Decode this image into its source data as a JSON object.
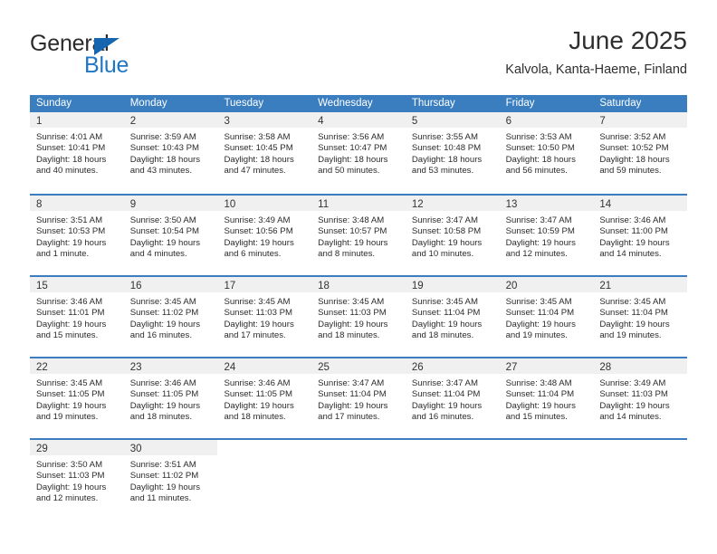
{
  "logo": {
    "word_top": "General",
    "word_bottom": "Blue",
    "triangle_color": "#1565b0",
    "blue_color": "#1f77c4"
  },
  "header": {
    "title": "June 2025",
    "location": "Kalvola, Kanta-Haeme, Finland"
  },
  "calendar": {
    "accent_color": "#3a7ebf",
    "date_band_color": "#f0f0f0",
    "weekdays": [
      "Sunday",
      "Monday",
      "Tuesday",
      "Wednesday",
      "Thursday",
      "Friday",
      "Saturday"
    ],
    "weeks": [
      [
        {
          "date": "1",
          "sunrise": "Sunrise: 4:01 AM",
          "sunset": "Sunset: 10:41 PM",
          "daylight_line1": "Daylight: 18 hours",
          "daylight_line2": "and 40 minutes."
        },
        {
          "date": "2",
          "sunrise": "Sunrise: 3:59 AM",
          "sunset": "Sunset: 10:43 PM",
          "daylight_line1": "Daylight: 18 hours",
          "daylight_line2": "and 43 minutes."
        },
        {
          "date": "3",
          "sunrise": "Sunrise: 3:58 AM",
          "sunset": "Sunset: 10:45 PM",
          "daylight_line1": "Daylight: 18 hours",
          "daylight_line2": "and 47 minutes."
        },
        {
          "date": "4",
          "sunrise": "Sunrise: 3:56 AM",
          "sunset": "Sunset: 10:47 PM",
          "daylight_line1": "Daylight: 18 hours",
          "daylight_line2": "and 50 minutes."
        },
        {
          "date": "5",
          "sunrise": "Sunrise: 3:55 AM",
          "sunset": "Sunset: 10:48 PM",
          "daylight_line1": "Daylight: 18 hours",
          "daylight_line2": "and 53 minutes."
        },
        {
          "date": "6",
          "sunrise": "Sunrise: 3:53 AM",
          "sunset": "Sunset: 10:50 PM",
          "daylight_line1": "Daylight: 18 hours",
          "daylight_line2": "and 56 minutes."
        },
        {
          "date": "7",
          "sunrise": "Sunrise: 3:52 AM",
          "sunset": "Sunset: 10:52 PM",
          "daylight_line1": "Daylight: 18 hours",
          "daylight_line2": "and 59 minutes."
        }
      ],
      [
        {
          "date": "8",
          "sunrise": "Sunrise: 3:51 AM",
          "sunset": "Sunset: 10:53 PM",
          "daylight_line1": "Daylight: 19 hours",
          "daylight_line2": "and 1 minute."
        },
        {
          "date": "9",
          "sunrise": "Sunrise: 3:50 AM",
          "sunset": "Sunset: 10:54 PM",
          "daylight_line1": "Daylight: 19 hours",
          "daylight_line2": "and 4 minutes."
        },
        {
          "date": "10",
          "sunrise": "Sunrise: 3:49 AM",
          "sunset": "Sunset: 10:56 PM",
          "daylight_line1": "Daylight: 19 hours",
          "daylight_line2": "and 6 minutes."
        },
        {
          "date": "11",
          "sunrise": "Sunrise: 3:48 AM",
          "sunset": "Sunset: 10:57 PM",
          "daylight_line1": "Daylight: 19 hours",
          "daylight_line2": "and 8 minutes."
        },
        {
          "date": "12",
          "sunrise": "Sunrise: 3:47 AM",
          "sunset": "Sunset: 10:58 PM",
          "daylight_line1": "Daylight: 19 hours",
          "daylight_line2": "and 10 minutes."
        },
        {
          "date": "13",
          "sunrise": "Sunrise: 3:47 AM",
          "sunset": "Sunset: 10:59 PM",
          "daylight_line1": "Daylight: 19 hours",
          "daylight_line2": "and 12 minutes."
        },
        {
          "date": "14",
          "sunrise": "Sunrise: 3:46 AM",
          "sunset": "Sunset: 11:00 PM",
          "daylight_line1": "Daylight: 19 hours",
          "daylight_line2": "and 14 minutes."
        }
      ],
      [
        {
          "date": "15",
          "sunrise": "Sunrise: 3:46 AM",
          "sunset": "Sunset: 11:01 PM",
          "daylight_line1": "Daylight: 19 hours",
          "daylight_line2": "and 15 minutes."
        },
        {
          "date": "16",
          "sunrise": "Sunrise: 3:45 AM",
          "sunset": "Sunset: 11:02 PM",
          "daylight_line1": "Daylight: 19 hours",
          "daylight_line2": "and 16 minutes."
        },
        {
          "date": "17",
          "sunrise": "Sunrise: 3:45 AM",
          "sunset": "Sunset: 11:03 PM",
          "daylight_line1": "Daylight: 19 hours",
          "daylight_line2": "and 17 minutes."
        },
        {
          "date": "18",
          "sunrise": "Sunrise: 3:45 AM",
          "sunset": "Sunset: 11:03 PM",
          "daylight_line1": "Daylight: 19 hours",
          "daylight_line2": "and 18 minutes."
        },
        {
          "date": "19",
          "sunrise": "Sunrise: 3:45 AM",
          "sunset": "Sunset: 11:04 PM",
          "daylight_line1": "Daylight: 19 hours",
          "daylight_line2": "and 18 minutes."
        },
        {
          "date": "20",
          "sunrise": "Sunrise: 3:45 AM",
          "sunset": "Sunset: 11:04 PM",
          "daylight_line1": "Daylight: 19 hours",
          "daylight_line2": "and 19 minutes."
        },
        {
          "date": "21",
          "sunrise": "Sunrise: 3:45 AM",
          "sunset": "Sunset: 11:04 PM",
          "daylight_line1": "Daylight: 19 hours",
          "daylight_line2": "and 19 minutes."
        }
      ],
      [
        {
          "date": "22",
          "sunrise": "Sunrise: 3:45 AM",
          "sunset": "Sunset: 11:05 PM",
          "daylight_line1": "Daylight: 19 hours",
          "daylight_line2": "and 19 minutes."
        },
        {
          "date": "23",
          "sunrise": "Sunrise: 3:46 AM",
          "sunset": "Sunset: 11:05 PM",
          "daylight_line1": "Daylight: 19 hours",
          "daylight_line2": "and 18 minutes."
        },
        {
          "date": "24",
          "sunrise": "Sunrise: 3:46 AM",
          "sunset": "Sunset: 11:05 PM",
          "daylight_line1": "Daylight: 19 hours",
          "daylight_line2": "and 18 minutes."
        },
        {
          "date": "25",
          "sunrise": "Sunrise: 3:47 AM",
          "sunset": "Sunset: 11:04 PM",
          "daylight_line1": "Daylight: 19 hours",
          "daylight_line2": "and 17 minutes."
        },
        {
          "date": "26",
          "sunrise": "Sunrise: 3:47 AM",
          "sunset": "Sunset: 11:04 PM",
          "daylight_line1": "Daylight: 19 hours",
          "daylight_line2": "and 16 minutes."
        },
        {
          "date": "27",
          "sunrise": "Sunrise: 3:48 AM",
          "sunset": "Sunset: 11:04 PM",
          "daylight_line1": "Daylight: 19 hours",
          "daylight_line2": "and 15 minutes."
        },
        {
          "date": "28",
          "sunrise": "Sunrise: 3:49 AM",
          "sunset": "Sunset: 11:03 PM",
          "daylight_line1": "Daylight: 19 hours",
          "daylight_line2": "and 14 minutes."
        }
      ],
      [
        {
          "date": "29",
          "sunrise": "Sunrise: 3:50 AM",
          "sunset": "Sunset: 11:03 PM",
          "daylight_line1": "Daylight: 19 hours",
          "daylight_line2": "and 12 minutes."
        },
        {
          "date": "30",
          "sunrise": "Sunrise: 3:51 AM",
          "sunset": "Sunset: 11:02 PM",
          "daylight_line1": "Daylight: 19 hours",
          "daylight_line2": "and 11 minutes."
        },
        {
          "date": "",
          "sunrise": "",
          "sunset": "",
          "daylight_line1": "",
          "daylight_line2": ""
        },
        {
          "date": "",
          "sunrise": "",
          "sunset": "",
          "daylight_line1": "",
          "daylight_line2": ""
        },
        {
          "date": "",
          "sunrise": "",
          "sunset": "",
          "daylight_line1": "",
          "daylight_line2": ""
        },
        {
          "date": "",
          "sunrise": "",
          "sunset": "",
          "daylight_line1": "",
          "daylight_line2": ""
        },
        {
          "date": "",
          "sunrise": "",
          "sunset": "",
          "daylight_line1": "",
          "daylight_line2": ""
        }
      ]
    ]
  }
}
